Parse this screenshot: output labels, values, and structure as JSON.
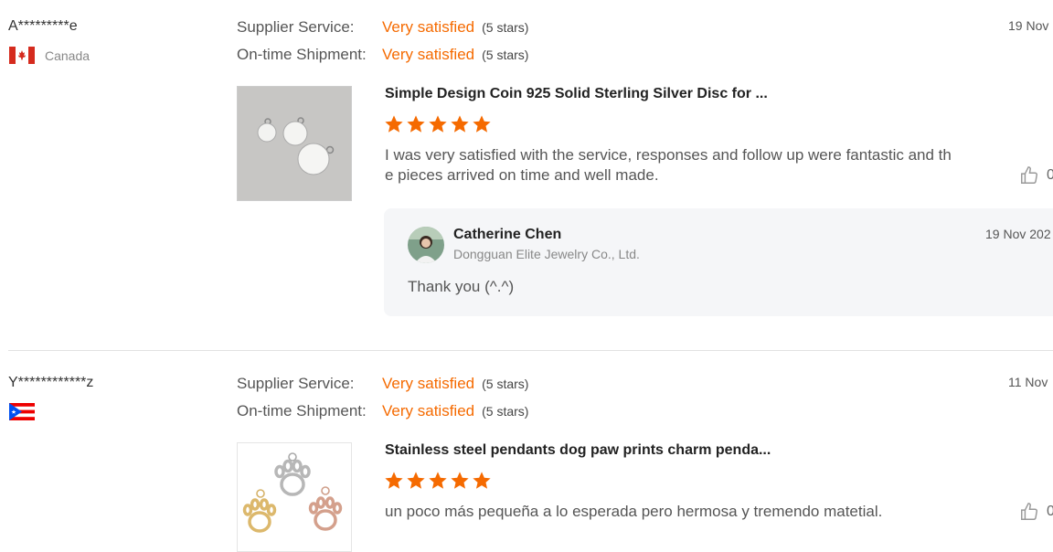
{
  "reviews": [
    {
      "reviewer": "A*********e",
      "country": "Canada",
      "flag_icon": "canada-flag-icon",
      "supplier_service_label": "Supplier Service:",
      "supplier_service_value": "Very satisfied",
      "supplier_service_stars": "(5 stars)",
      "shipment_label": "On-time Shipment:",
      "shipment_value": "Very satisfied",
      "shipment_stars": "(5 stars)",
      "date": "19 Nov",
      "product_title": "Simple Design Coin 925 Solid Sterling Silver Disc for ...",
      "rating": 5,
      "text": "I was very satisfied with the service, responses and follow up were fantastic and the pieces arrived on time and well made.",
      "like_count": "0",
      "reply": {
        "name": "Catherine Chen",
        "company": "Dongguan Elite Jewelry Co., Ltd.",
        "date": "19 Nov 202",
        "text": "Thank you (^.^)"
      }
    },
    {
      "reviewer": "Y************z",
      "country": "",
      "flag_icon": "puerto-rico-flag-icon",
      "supplier_service_label": "Supplier Service:",
      "supplier_service_value": "Very satisfied",
      "supplier_service_stars": "(5 stars)",
      "shipment_label": "On-time Shipment:",
      "shipment_value": "Very satisfied",
      "shipment_stars": "(5 stars)",
      "date": "11 Nov",
      "product_title": "Stainless steel pendants dog paw prints charm penda...",
      "rating": 5,
      "text": "un poco más pequeña a lo esperada pero hermosa y tremendo matetial.",
      "like_count": "0"
    }
  ],
  "colors": {
    "accent": "#f56a00",
    "star": "#f56a00",
    "reply_bg": "#f5f6f8"
  }
}
